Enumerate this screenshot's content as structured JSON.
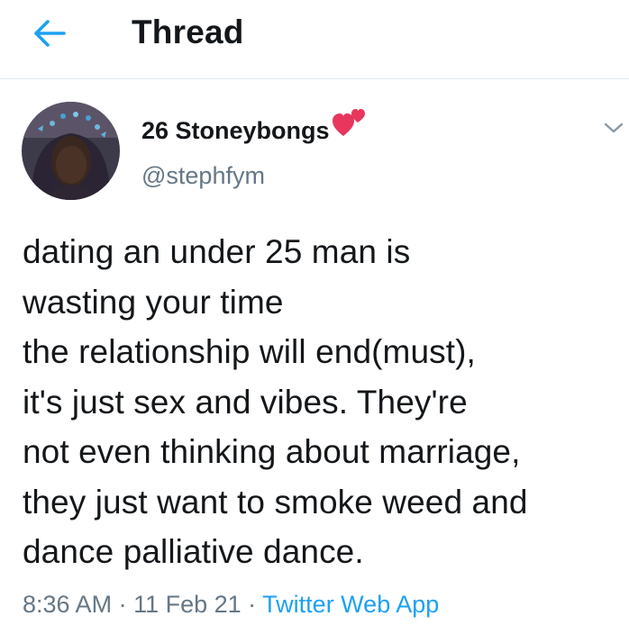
{
  "header": {
    "back_icon": "arrow-left-icon",
    "title": "Thread"
  },
  "tweet": {
    "author": {
      "display_name": "26 Stoneybongs",
      "name_emoji_icon": "two-hearts-icon",
      "handle": "@stephfym"
    },
    "menu_icon": "chevron-down-icon",
    "text": "dating an under 25 man is\nwasting your time\nthe relationship will end(must),\nit's just sex and vibes. They're\nnot even thinking about marriage,\nthey just want to smoke weed and\ndance palliative dance.",
    "time": "8:36 AM",
    "separator": " · ",
    "date": "11 Feb 21",
    "source": "Twitter Web App"
  },
  "colors": {
    "accent": "#1da1f2",
    "text": "#14171a",
    "secondary": "#657786",
    "divider": "#e1e8ed"
  }
}
